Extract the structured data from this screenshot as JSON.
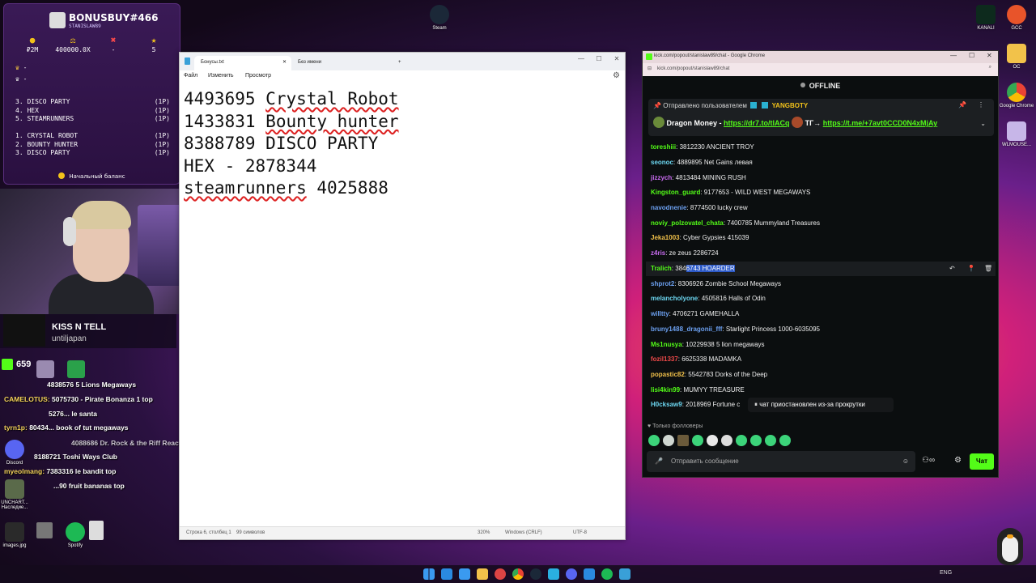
{
  "bonus": {
    "title": "BONUSBUY#466",
    "subtitle": "STANISLAW89",
    "stats": [
      {
        "icon": "coin-icon",
        "symbol": "●",
        "value": "₽2M",
        "color": "#f2c21a"
      },
      {
        "icon": "scale-icon",
        "symbol": "⚖",
        "value": "400000.0X",
        "color": "#f2c21a"
      },
      {
        "icon": "cross-icon",
        "symbol": "✖",
        "value": "-",
        "color": "#ff4a4a"
      },
      {
        "icon": "star-icon",
        "symbol": "★",
        "value": "5",
        "color": "#f2c21a"
      }
    ],
    "crowns": [
      "-",
      "-"
    ],
    "list1": [
      {
        "name": "3. DISCO PARTY",
        "count": "(1P)"
      },
      {
        "name": "4. HEX",
        "count": "(1P)"
      },
      {
        "name": "5. STEAMRUNNERS",
        "count": "(1P)"
      }
    ],
    "list2": [
      {
        "name": "1. CRYSTAL ROBOT",
        "count": "(1P)"
      },
      {
        "name": "2. BOUNTY HUNTER",
        "count": "(1P)"
      },
      {
        "name": "3. DISCO PARTY",
        "count": "(1P)"
      }
    ],
    "footer": "Начальный баланс"
  },
  "music": {
    "song": "KISS N TELL",
    "artist": "untiljapan"
  },
  "desktop_icons": {
    "steam": "Steam",
    "kanali": "KANALI",
    "gcc": "GCC",
    "oc": "OC",
    "chrome": "Google Chrome",
    "wlmouse": "WLMOUSE...",
    "discord": "Discord",
    "spotify": "Spotify",
    "images": "images.jpg",
    "unchart": "UNCHART... Наследие..."
  },
  "kick_badge": "659",
  "overlay_chat": [
    {
      "user": "",
      "msg": "4838576 5 Lions Megaways"
    },
    {
      "user": "CAMELOTUS:",
      "msg": "5075730 - Pirate Bonanza 1 top"
    },
    {
      "user": "",
      "msg": "5276... le santa"
    },
    {
      "user": "tyrn1p:",
      "msg": "80434... book of tut megaways"
    },
    {
      "user": "",
      "msg": "4088686 Dr. Rock & the Riff Reactor TOP"
    },
    {
      "user": "",
      "msg": "8188721 Toshi Ways Club"
    },
    {
      "user": "myeolmang:",
      "msg": "7383316 le bandit top"
    },
    {
      "user": "",
      "msg": "...90 fruit bananas top"
    }
  ],
  "notepad": {
    "tab_active": "Бонусы.txt",
    "tab_other": "Без имени",
    "new_tab": "+",
    "menu": [
      "Файл",
      "Изменить",
      "Просмотр"
    ],
    "lines": [
      {
        "num": "4493695",
        "text": "Crystal Robot",
        "spell": true
      },
      {
        "num": "1433831",
        "text": "Bounty hunter",
        "spell": true
      },
      {
        "num": "8388789",
        "text": "DISCO PARTY",
        "spell": false
      },
      {
        "num": "",
        "text": "HEX - 2878344",
        "spell": false
      },
      {
        "num": "",
        "text": "steamrunners",
        "spell": true,
        "suffix": " 4025888"
      }
    ],
    "status": {
      "position": "Строка 6, столбец 1",
      "chars": "99 символов",
      "zoom": "320%",
      "eol": "Windows (CRLF)",
      "encoding": "UTF-8"
    }
  },
  "chrome": {
    "title": "kick.com/popout/stanislaw89/chat - Google Chrome",
    "url": "kick.com/popout/stanislaw89/chat",
    "status": "OFFLINE",
    "pinned": {
      "label": "Отправлено пользователем",
      "by": "YANGBOTY",
      "line": "Dragon Money -",
      "link1": "https://dr7.to/tlACq",
      "mid": "ТГ→",
      "link2": "https://t.me/+7avt0CCD0N4xMjAy"
    },
    "messages": [
      {
        "user": "toreshiii",
        "color": "#53fc18",
        "msg": ": 3812230 ANCIENT TROY"
      },
      {
        "user": "seonoc",
        "color": "#6cd6f0",
        "msg": ": 4889895 Net Gains левая"
      },
      {
        "user": "jizzych",
        "color": "#c86cf0",
        "msg": ": 4813484 MINING RUSH"
      },
      {
        "user": "Kingston_guard",
        "color": "#53fc18",
        "msg": ": 9177653 - WILD WEST MEGAWAYS"
      },
      {
        "user": "navodnenie",
        "color": "#6ca0f0",
        "msg": ": 8774500 lucky crew"
      },
      {
        "user": "noviy_polzovatel_chata",
        "color": "#53fc18",
        "msg": ": 7400785 Mummyland Treasures"
      },
      {
        "user": "Jeka1003",
        "color": "#f0c04a",
        "msg": ": Cyber Gypsies 415039"
      },
      {
        "user": "z4ris",
        "color": "#c86cf0",
        "msg": ": ze zeus 2286724"
      },
      {
        "user": "Tralich",
        "color": "#53fc18",
        "msg": ": 384",
        "hl": "6743 HOARDER"
      },
      {
        "user": "shprot2",
        "color": "#6ca0f0",
        "msg": ": 8306926 Zombie School Megaways"
      },
      {
        "user": "melancholyone",
        "color": "#6cd6f0",
        "msg": ": 4505816 Halls of Odin"
      },
      {
        "user": "willtty",
        "color": "#6ca0f0",
        "msg": ": 4706271 GAMEHALLA"
      },
      {
        "user": "bruny1488_dragonii_fff",
        "color": "#6ca0f0",
        "msg": ": Starlight Princess 1000-6035095"
      },
      {
        "user": "Ms1nusya",
        "color": "#53fc18",
        "msg": ": 10229938 5 lion megaways"
      },
      {
        "user": "fozil1337",
        "color": "#f04a4a",
        "msg": ": 6625338 MADAMKA"
      },
      {
        "user": "popastic82",
        "color": "#f0c04a",
        "msg": ": 5542783 Dorks of the Deep"
      },
      {
        "user": "lisi4kin99",
        "color": "#53fc18",
        "msg": ": MUMYY TREASURE"
      },
      {
        "user": "H0cksaw9",
        "color": "#6cd6f0",
        "msg": ": 2018969 Fortune c"
      }
    ],
    "paused": "чат приостановлен из-за прокрутки",
    "followers_only": "Только фолловеры",
    "input_placeholder": "Отправить сообщение",
    "send": "Чат"
  },
  "taskbar": {
    "lang": "ENG"
  }
}
